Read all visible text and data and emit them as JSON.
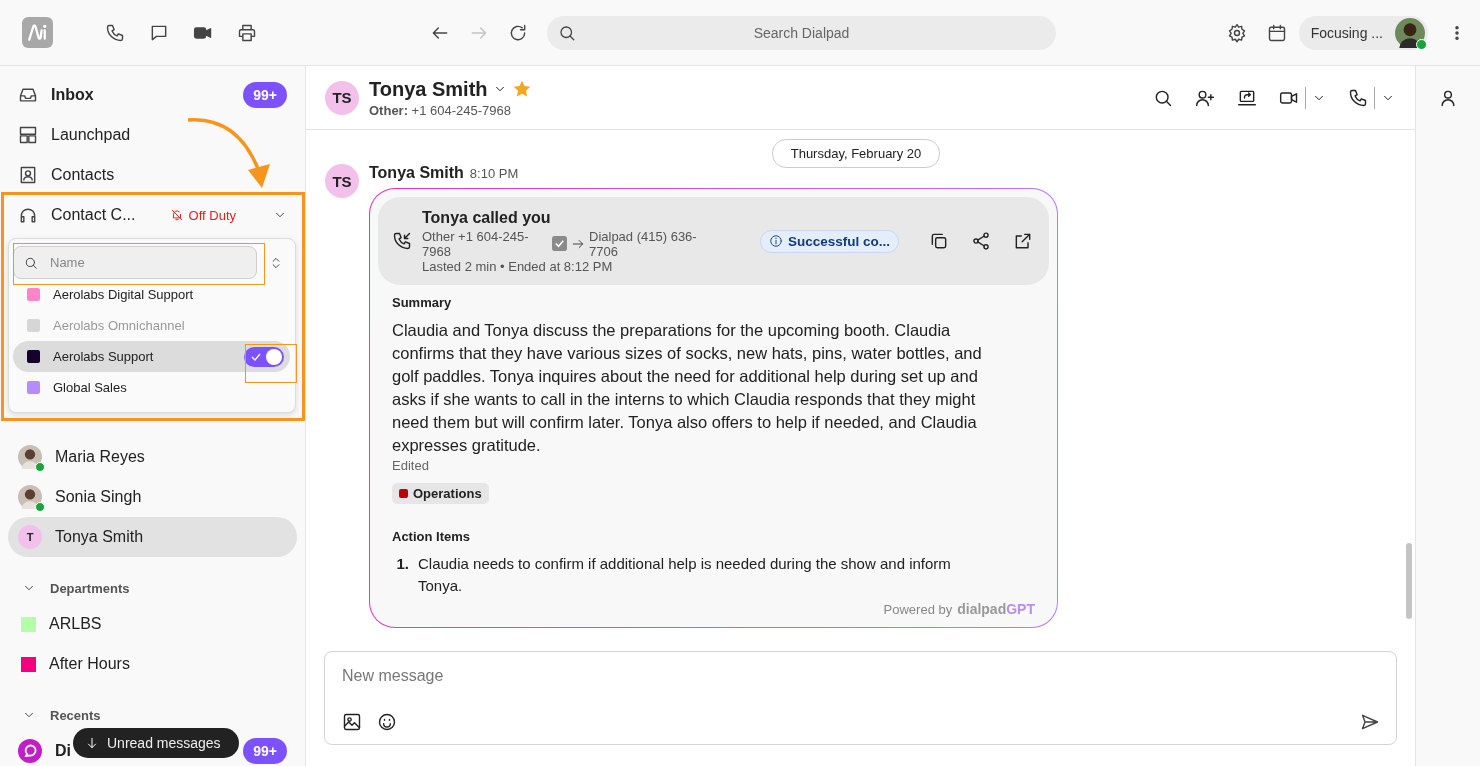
{
  "top_bar": {
    "apps": [
      {
        "kind": "phone"
      },
      {
        "kind": "chat"
      },
      {
        "kind": "video"
      },
      {
        "kind": "print"
      }
    ],
    "nav": [
      {
        "kind": "back",
        "disabled": false
      },
      {
        "kind": "forward",
        "disabled": true
      },
      {
        "kind": "refresh",
        "disabled": false
      }
    ],
    "search": {
      "placeholder": "Search Dialpad"
    },
    "status": {
      "label": "Focusing ...",
      "online": true
    }
  },
  "sidebar": {
    "nav": [
      {
        "kind": "inbox",
        "label": "Inbox",
        "unread": true,
        "badge": "99+"
      },
      {
        "kind": "launchpad",
        "label": "Launchpad",
        "unread": false
      },
      {
        "kind": "contacts",
        "label": "Contacts",
        "unread": false
      }
    ],
    "contact_center": {
      "label": "Contact C...",
      "status": "Off Duty",
      "expanded": true
    },
    "queue_menu": {
      "search": {
        "placeholder": "Name"
      },
      "items": [
        {
          "label": "Aerolabs Digital Support",
          "color": "#ff85c8",
          "disabled": false,
          "selected": false,
          "on": false
        },
        {
          "label": "Aerolabs Omnichannel",
          "color": "#d6d6d6",
          "disabled": true,
          "selected": false,
          "on": false
        },
        {
          "label": "Aerolabs Support",
          "color": "#16002e",
          "disabled": false,
          "selected": true,
          "on": true
        },
        {
          "label": "Global Sales",
          "color": "#b58cff",
          "disabled": false,
          "selected": false,
          "on": false
        }
      ]
    },
    "contacts": [
      {
        "name": "Maria Reyes",
        "kind": "photo",
        "online": true,
        "selected": false
      },
      {
        "name": "Sonia Singh",
        "kind": "photo",
        "online": true,
        "selected": false
      },
      {
        "name": "Tonya Smith",
        "kind": "initial",
        "initial": "T",
        "online": false,
        "selected": true
      }
    ],
    "departments": {
      "title": "Departments",
      "expanded": true,
      "items": [
        {
          "label": "ARLBS",
          "color": "#b3ffa8"
        },
        {
          "label": "After Hours",
          "color": "#f5007f"
        }
      ]
    },
    "recents": {
      "title": "Recents",
      "expanded": true,
      "items": [
        {
          "label": "Di",
          "badge": "99+",
          "unread": true
        }
      ]
    },
    "unread_toast": {
      "label": "Unread messages"
    }
  },
  "conversation": {
    "header": {
      "initials": "TS",
      "name": "Tonya Smith",
      "starred": true,
      "subtitle": "**Other:** +1 604-245-7968"
    },
    "date": "Thursday, February 20",
    "message": {
      "initials": "TS",
      "sender": "Tonya Smith",
      "time": "8:10 PM",
      "call": {
        "title": "Tonya called you",
        "from": "Other +1 604-245-7968",
        "to": "Dialpad (415) 636-7706",
        "details": "Lasted 2 min • Ended at 8:12 PM",
        "status": "Successful co..."
      },
      "summary": {
        "title": "Summary",
        "text": "Claudia and Tonya discuss the preparations for the upcoming booth. Claudia confirms that they have various sizes of socks, new hats, pins, water bottles, and golf paddles. Tonya inquires about the need for additional help during set up and asks if she wants to call in the interns to which Claudia responds that they might need them but will confirm later. Tonya also offers to help if needed, and Claudia expresses gratitude.",
        "edited": "Edited",
        "tags": [
          {
            "label": "Operations",
            "color": "#c00000"
          }
        ]
      },
      "action_items": {
        "title": "Action Items",
        "items": [
          {
            "number": "1.",
            "text": "Claudia needs to confirm if additional help is needed during the show and inform Tonya."
          }
        ]
      },
      "powered_by": {
        "label": "Powered by",
        "brand": "dialpad",
        "brand_accent": "GPT"
      }
    },
    "composer": {
      "placeholder": "New message"
    }
  }
}
